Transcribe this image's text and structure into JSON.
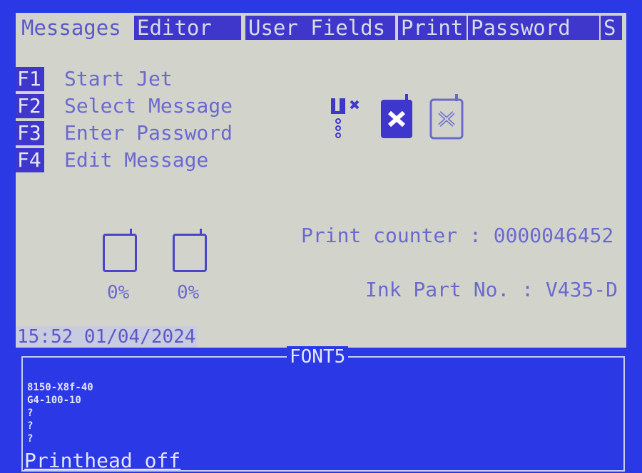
{
  "menu": {
    "items": [
      {
        "label": "Messages",
        "active": true
      },
      {
        "label": "Editor",
        "active": false
      },
      {
        "label": "User Fields",
        "active": false
      },
      {
        "label": "Print",
        "active": false
      },
      {
        "label": "Password",
        "active": false
      },
      {
        "label": "S",
        "active": false
      }
    ]
  },
  "fkeys": [
    {
      "key": "F1",
      "label": "Start Jet"
    },
    {
      "key": "F2",
      "label": "Select Message"
    },
    {
      "key": "F3",
      "label": "Enter Password"
    },
    {
      "key": "F4",
      "label": "Edit Message"
    }
  ],
  "status_icons": [
    "printhead-off-icon",
    "ink-cartridge-missing-icon",
    "solvent-cartridge-missing-icon"
  ],
  "ink_levels": [
    {
      "percent_text": "0%",
      "level": 0
    },
    {
      "percent_text": "0%",
      "level": 0
    }
  ],
  "print_counter": "Print counter : 0000046452",
  "ink_part": "Ink Part No. : V435-D",
  "datetime": "15:52 01/04/2024",
  "console": {
    "title": "FONT5",
    "lines": [
      "8150-X8f-40",
      "G4-100-10",
      "?",
      "?",
      "?"
    ],
    "status": "Printhead off"
  },
  "colors": {
    "background": "#2a38e6",
    "screen": "#d2d4cb",
    "accent": "#3f36cc",
    "text": "#6b69cf"
  }
}
